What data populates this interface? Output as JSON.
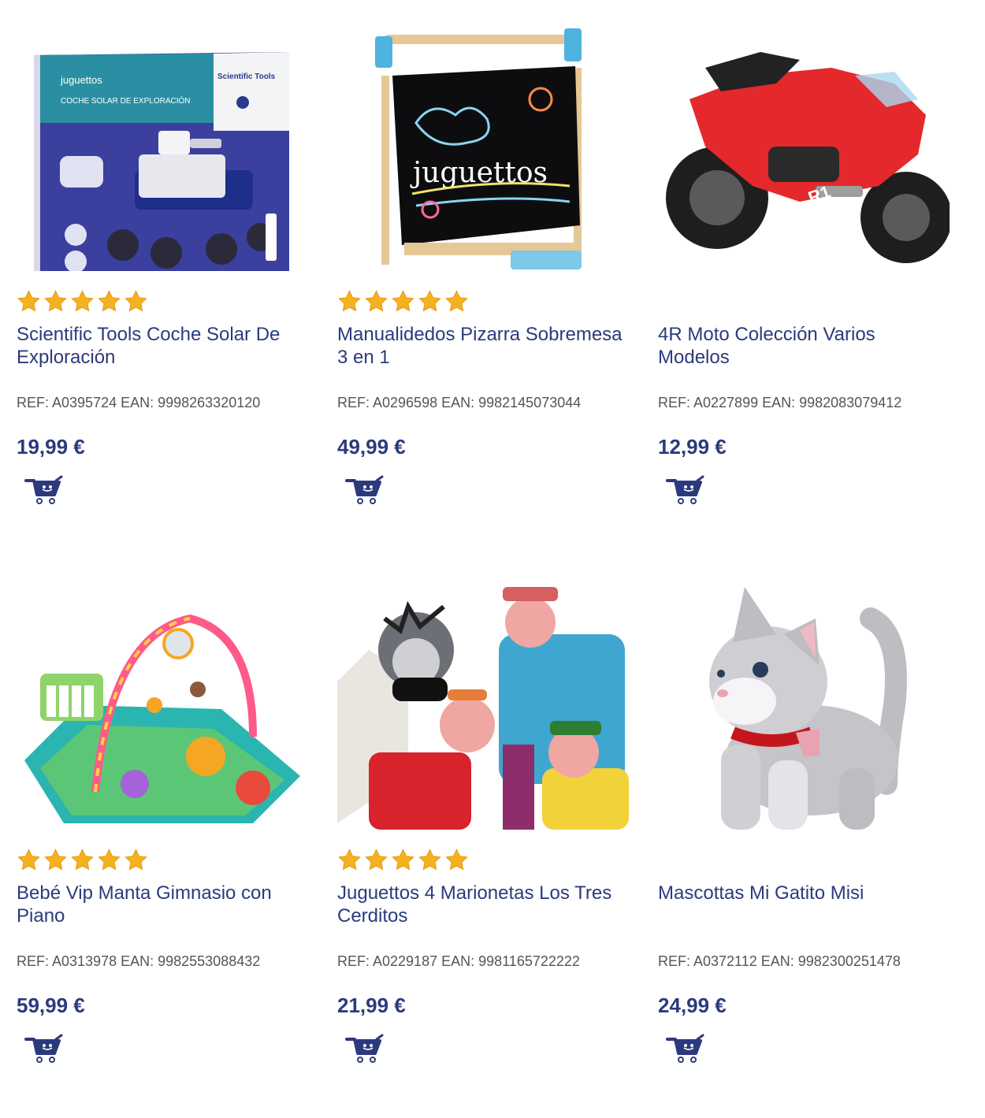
{
  "colors": {
    "title": "#2c3a7d",
    "price": "#2c3a7d",
    "ref": "#555555",
    "star": "#f5b21f",
    "cart": "#2c3a7d"
  },
  "icons": {
    "rating": "star-icon",
    "cart": "shopping-cart-icon"
  },
  "products": [
    {
      "title": "Scientific Tools Coche Solar De Exploración",
      "ref": "REF: A0395724 EAN: 9998263320120",
      "price": "19,99 €",
      "stars": 5,
      "image_text": {
        "brand": "juguettos",
        "box_title": "COCHE SOLAR DE EXPLORACIÓN",
        "logo": "Scientific Tools"
      }
    },
    {
      "title": "Manualidedos Pizarra Sobremesa 3 en 1",
      "ref": "REF: A0296598 EAN: 9982145073044",
      "price": "49,99 €",
      "stars": 5,
      "image_text": {
        "board_text": "juguettos"
      }
    },
    {
      "title": "4R Moto Colección Varios Modelos",
      "ref": "REF: A0227899 EAN: 9982083079412",
      "price": "12,99 €",
      "stars": 0
    },
    {
      "title": "Bebé Vip Manta Gimnasio con Piano",
      "ref": "REF: A0313978 EAN: 9982553088432",
      "price": "59,99 €",
      "stars": 5
    },
    {
      "title": "Juguettos 4 Marionetas Los Tres Cerditos",
      "ref": "REF: A0229187 EAN: 9981165722222",
      "price": "21,99 €",
      "stars": 5
    },
    {
      "title": "Mascottas Mi Gatito Misi",
      "ref": "REF: A0372112 EAN: 9982300251478",
      "price": "24,99 €",
      "stars": 0
    }
  ]
}
